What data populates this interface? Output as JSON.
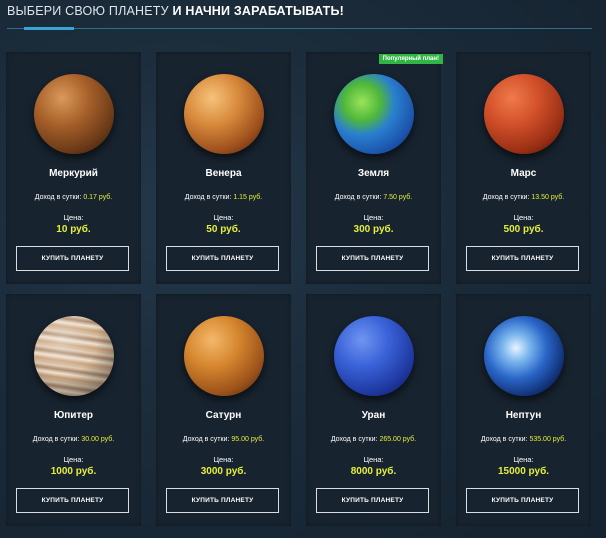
{
  "header": {
    "title_light": "ВЫБЕРИ СВОЮ ПЛАНЕТУ",
    "title_bold": "И НАЧНИ ЗАРАБАТЫВАТЬ!"
  },
  "labels": {
    "income_prefix": "Доход в сутки:",
    "price_label": "Цена:",
    "buy_button": "КУПИТЬ ПЛАНЕТУ",
    "popular_badge": "Популярный план!"
  },
  "colors": {
    "accent_yellow": "#e6ef3a",
    "badge_green": "#31b545",
    "header_line": "#2f6e8e"
  },
  "planets": [
    {
      "name": "Меркурий",
      "income": "0.17 руб.",
      "price": "10 руб.",
      "icon": "mercury-planet"
    },
    {
      "name": "Венера",
      "income": "1.15 руб.",
      "price": "50 руб.",
      "icon": "venus-planet"
    },
    {
      "name": "Земля",
      "income": "7.50 руб.",
      "price": "300 руб.",
      "icon": "earth-planet",
      "popular": true
    },
    {
      "name": "Марс",
      "income": "13.50 руб.",
      "price": "500 руб.",
      "icon": "mars-planet"
    },
    {
      "name": "Юпитер",
      "income": "30.00 руб.",
      "price": "1000 руб.",
      "icon": "jupiter-planet"
    },
    {
      "name": "Сатурн",
      "income": "95.00 руб.",
      "price": "3000 руб.",
      "icon": "saturn-planet"
    },
    {
      "name": "Уран",
      "income": "265.00 руб.",
      "price": "8000 руб.",
      "icon": "uranus-planet"
    },
    {
      "name": "Нептун",
      "income": "535.00 руб.",
      "price": "15000 руб.",
      "icon": "neptune-planet"
    }
  ]
}
